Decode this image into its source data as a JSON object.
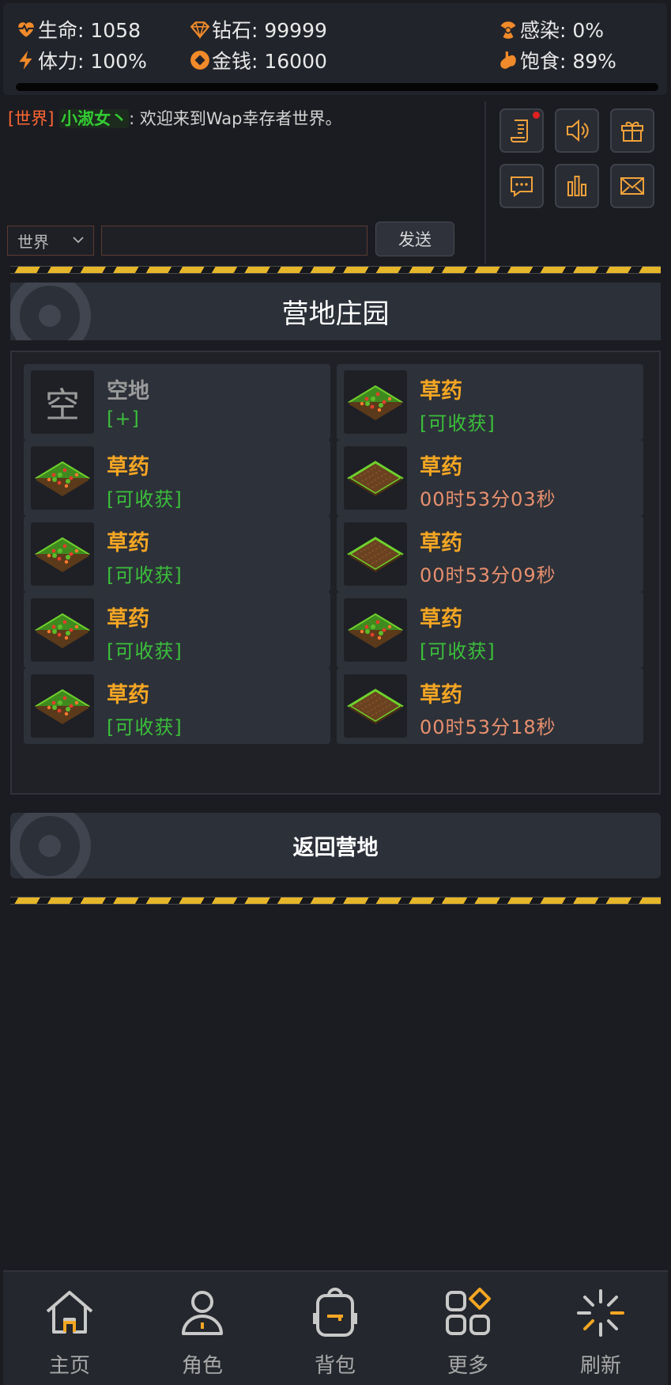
{
  "status": {
    "hp_label": "生命: 1058",
    "diamond_label": "钻石: 99999",
    "infection_label": "感染: 0%",
    "stamina_label": "体力: 100%",
    "money_label": "金钱: 16000",
    "satiety_label": "饱食: 89%"
  },
  "chat": {
    "channel_tag": "[世界]",
    "sender": "小淑女丶",
    "message": ": 欢迎来到Wap幸存者世界。",
    "channel_select": "世界",
    "input_value": "",
    "send_label": "发送"
  },
  "page": {
    "title": "营地庄园"
  },
  "plots": [
    {
      "name": "空地",
      "status": "[+]",
      "state": "empty"
    },
    {
      "name": "草药",
      "status": "[可收获]",
      "state": "ready"
    },
    {
      "name": "草药",
      "status": "[可收获]",
      "state": "ready"
    },
    {
      "name": "草药",
      "status": "00时53分03秒",
      "state": "growing"
    },
    {
      "name": "草药",
      "status": "[可收获]",
      "state": "ready"
    },
    {
      "name": "草药",
      "status": "00时53分09秒",
      "state": "growing"
    },
    {
      "name": "草药",
      "status": "[可收获]",
      "state": "ready"
    },
    {
      "name": "草药",
      "status": "[可收获]",
      "state": "ready"
    },
    {
      "name": "草药",
      "status": "[可收获]",
      "state": "ready"
    },
    {
      "name": "草药",
      "status": "00时53分18秒",
      "state": "growing"
    }
  ],
  "empty_plot_glyph": "空",
  "back_button": {
    "label": "返回营地"
  },
  "nav": {
    "home": "主页",
    "role": "角色",
    "bag": "背包",
    "more": "更多",
    "refresh": "刷新"
  },
  "colors": {
    "accent": "#f5a623",
    "ready": "#3bbf3b",
    "timer": "#e8906e",
    "hazard": "#e6b62a"
  }
}
